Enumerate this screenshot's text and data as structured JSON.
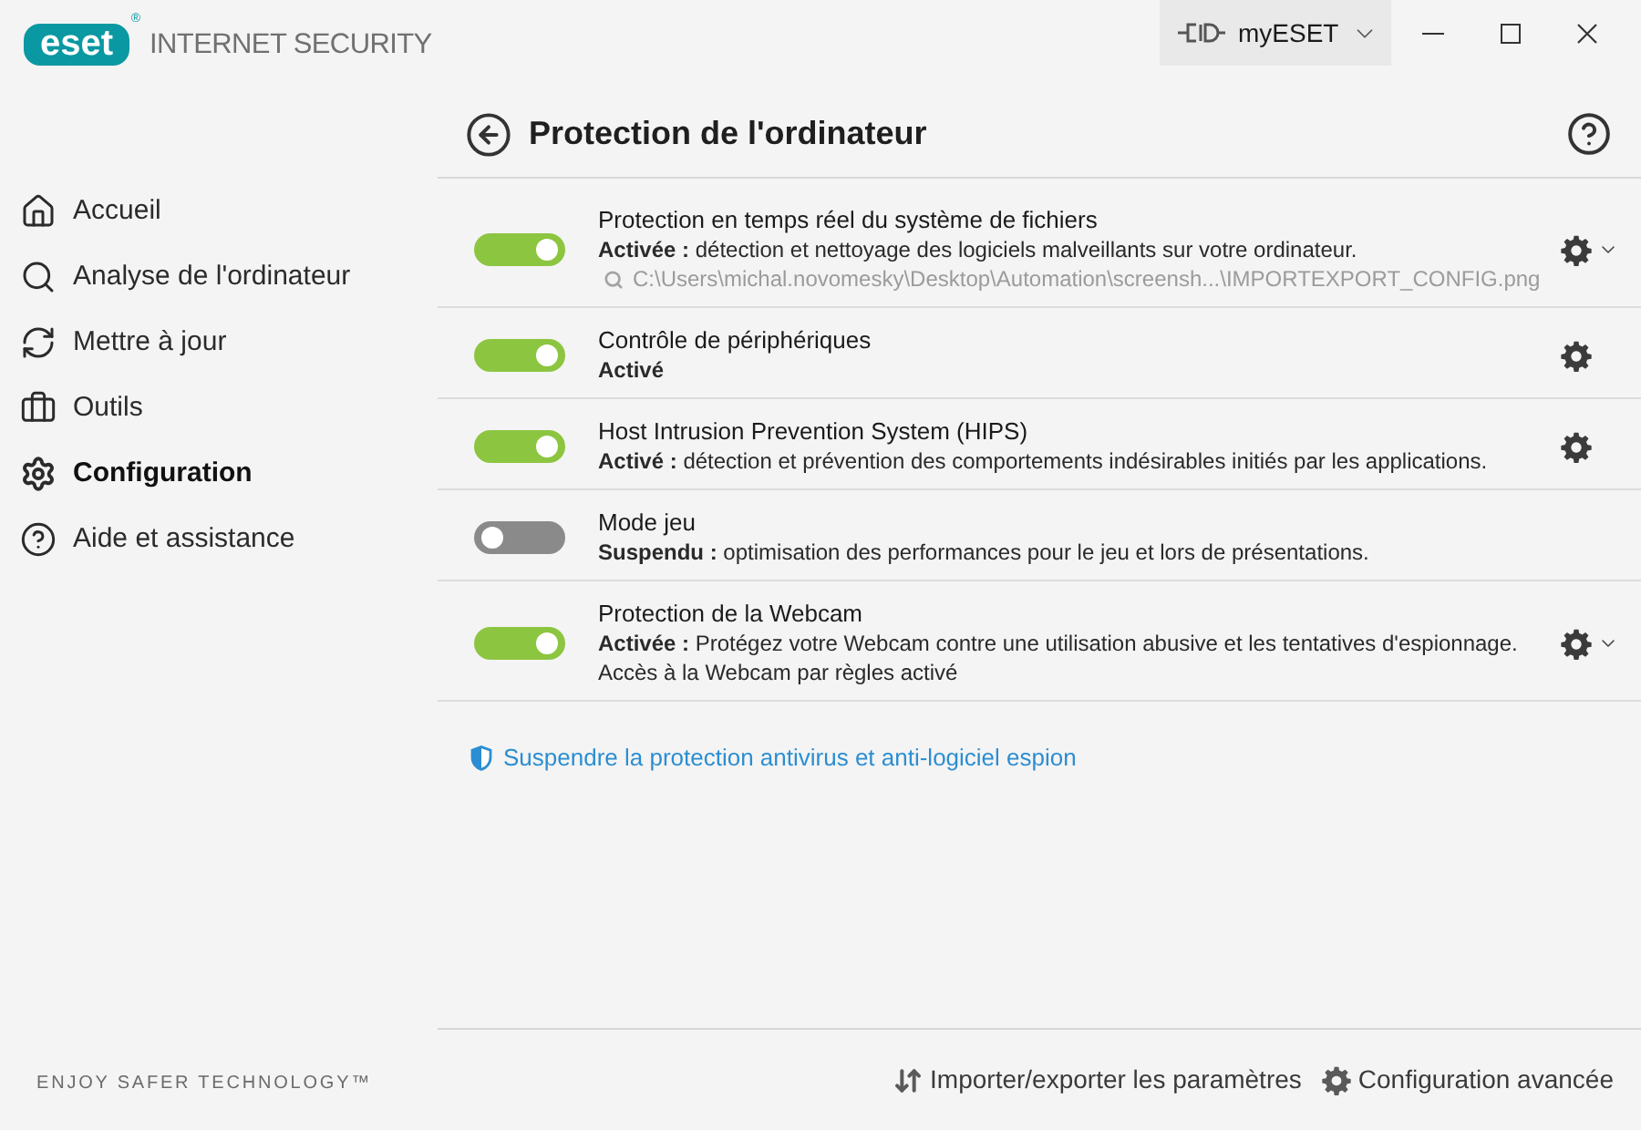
{
  "header": {
    "logo": "eset",
    "logo_mark": "®",
    "product": "INTERNET SECURITY",
    "account_button": "myESET"
  },
  "sidebar": {
    "items": [
      {
        "label": "Accueil",
        "selected": false
      },
      {
        "label": "Analyse de l'ordinateur",
        "selected": false
      },
      {
        "label": "Mettre à jour",
        "selected": false
      },
      {
        "label": "Outils",
        "selected": false
      },
      {
        "label": "Configuration",
        "selected": true
      },
      {
        "label": "Aide et assistance",
        "selected": false
      }
    ],
    "tagline": "ENJOY SAFER TECHNOLOGY™"
  },
  "page": {
    "title": "Protection de l'ordinateur"
  },
  "modules": [
    {
      "name": "Protection en temps réel du système de fichiers",
      "on": true,
      "status": "Activée :",
      "description": "détection et nettoyage des logiciels malveillants sur votre ordinateur.",
      "path": "C:\\Users\\michal.novomesky\\Desktop\\Automation\\screensh...\\IMPORTEXPORT_CONFIG.png",
      "settings": true,
      "expandable": true
    },
    {
      "name": "Contrôle de périphériques",
      "on": true,
      "status": "Activé",
      "settings": true,
      "expandable": false
    },
    {
      "name": "Host Intrusion Prevention System (HIPS)",
      "on": true,
      "status": "Activé :",
      "description": "détection et prévention des comportements indésirables initiés par les applications.",
      "settings": true,
      "expandable": false
    },
    {
      "name": "Mode jeu",
      "on": false,
      "status": "Suspendu :",
      "description": "optimisation des performances pour le jeu et lors de présentations.",
      "settings": false,
      "expandable": false
    },
    {
      "name": "Protection de la Webcam",
      "on": true,
      "status": "Activée :",
      "description": "Protégez votre Webcam contre une utilisation abusive et les tentatives d'espionnage.",
      "note": "Accès à la Webcam par règles activé",
      "settings": true,
      "expandable": true
    }
  ],
  "suspend_link": "Suspendre la protection antivirus et anti-logiciel espion",
  "footer": {
    "actions": [
      {
        "label": "Importer/exporter les paramètres"
      },
      {
        "label": "Configuration avancée"
      }
    ]
  }
}
